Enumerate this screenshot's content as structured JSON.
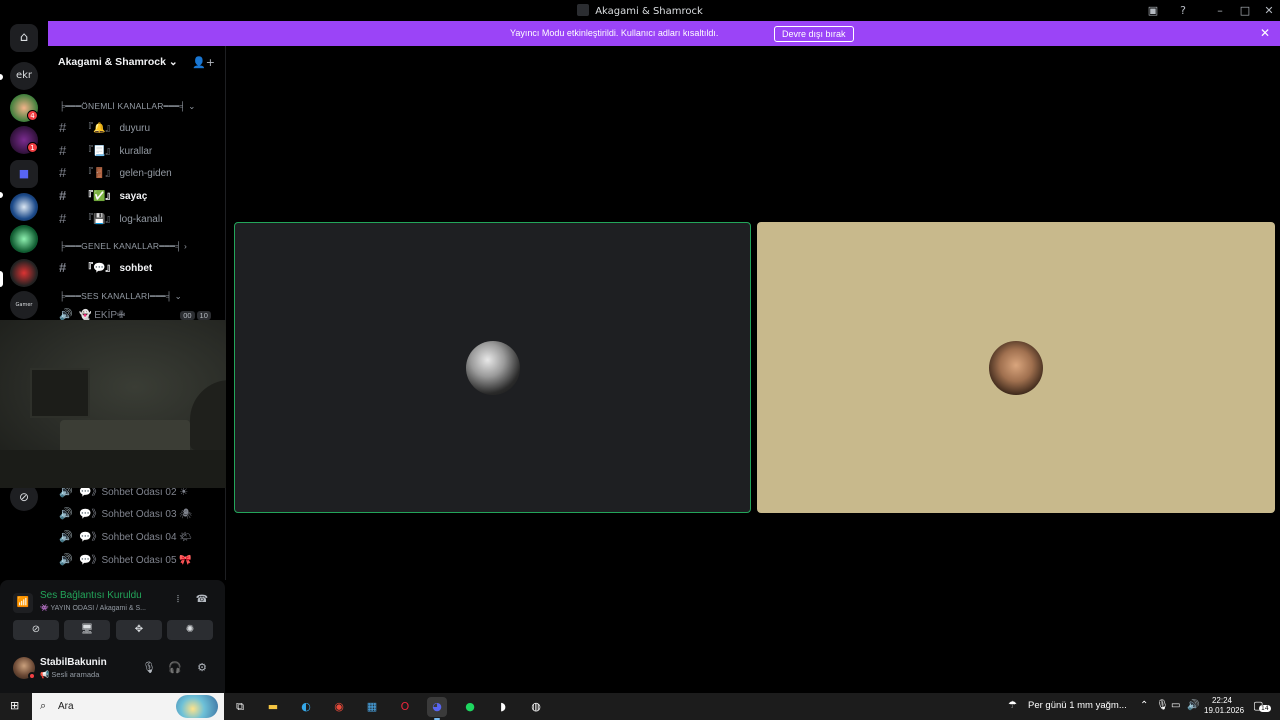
{
  "window": {
    "title": "Akagami & Shamrock",
    "controls": {
      "inbox_icon": "inbox-icon",
      "help_icon": "help-icon",
      "minimize": "–",
      "maximize": "□",
      "close": "✕"
    }
  },
  "banner": {
    "message": "Yayıncı Modu etkinleştirildi. Kullanıcı adları kısaltıldı.",
    "button_label": "Devre dışı bırak",
    "close_glyph": "✕",
    "color": "#9b44f7"
  },
  "guilds": {
    "home_glyph": "⌂",
    "items": [
      {
        "label": "ekr"
      },
      {
        "badge": "4"
      },
      {
        "badge": "1"
      },
      {
        "label": ""
      },
      {
        "label": ""
      },
      {
        "label": ""
      },
      {
        "label": ""
      },
      {
        "label": ""
      },
      {
        "label": "Gamer"
      }
    ],
    "discover_glyph": "⊘"
  },
  "server": {
    "name": "Akagami & Shamrock",
    "categories": [
      {
        "label": "╞━━━ÖNEMLİ KANALLAR━━━╡",
        "chevron": "⌄"
      },
      {
        "label": "╞━━━GENEL KANALLAR━━━╡",
        "chevron": "›"
      },
      {
        "label": "╞━━━SES KANALLARI━━━╡",
        "chevron": "⌄"
      }
    ],
    "text_channels": [
      {
        "emoji": "『🔔』",
        "name": "duyuru"
      },
      {
        "emoji": "『📃』",
        "name": "kurallar"
      },
      {
        "emoji": "『🚪』",
        "name": "gelen-giden"
      },
      {
        "emoji": "『✅』",
        "name": "sayaç"
      },
      {
        "emoji": "『💾』",
        "name": "log-kanalı"
      },
      {
        "emoji": "『💬』",
        "name": "sohbet"
      }
    ],
    "voice_channels": [
      {
        "name": "👻 EKİP✙",
        "count_a": "00",
        "count_b": "10"
      },
      {
        "name": "💬》Sohbet Odası 02 ☀"
      },
      {
        "name": "💬》Sohbet Odası 03 🕷"
      },
      {
        "name": "💬》Sohbet Odası 04 🌤"
      },
      {
        "name": "💬》Sohbet Odası 05 🎀"
      }
    ]
  },
  "voice_panel": {
    "status": "Ses Bağlantısı Kuruldu",
    "channel": "👾 YAYIN ODASI / Akagami & S...",
    "actions": [
      "camera-off-icon",
      "screen-share-icon",
      "activities-icon",
      "soundboard-icon"
    ],
    "user": {
      "name": "StabilBakunin",
      "status": "📢 Sesli aramada"
    },
    "colors": {
      "connected": "#23a55a"
    }
  },
  "taskbar": {
    "search_placeholder": "Ara",
    "weather": "Per günü 1 mm yağm...",
    "time": "22:24",
    "date": "19.01.2026",
    "notifications": "14"
  }
}
